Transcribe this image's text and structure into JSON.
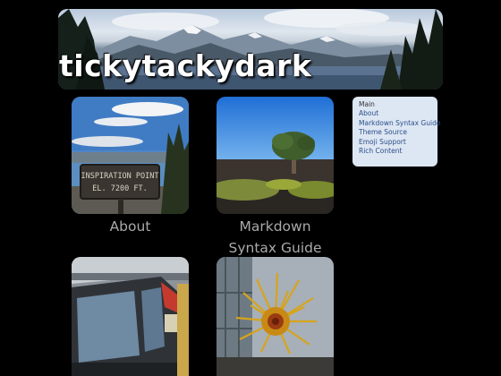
{
  "site": {
    "title": "tickytackydark"
  },
  "cards": [
    {
      "label": "About"
    },
    {
      "label": "Markdown Syntax Guide"
    },
    {
      "label": ""
    },
    {
      "label": ""
    }
  ],
  "photo_signs": {
    "sign_line_1": "INSPIRATION POINT",
    "sign_line_2": "EL. 7200 FT."
  },
  "menu": {
    "items": [
      {
        "label": "Main"
      },
      {
        "label": "About"
      },
      {
        "label": "Markdown Syntax Guide"
      },
      {
        "label": "Theme Source"
      },
      {
        "label": "Emoji Support"
      },
      {
        "label": "Rich Content"
      }
    ]
  },
  "colors": {
    "background": "#000000",
    "menu_bg": "#dde6f3",
    "link": "#2a4f8a",
    "caption": "#aaaaaa"
  }
}
